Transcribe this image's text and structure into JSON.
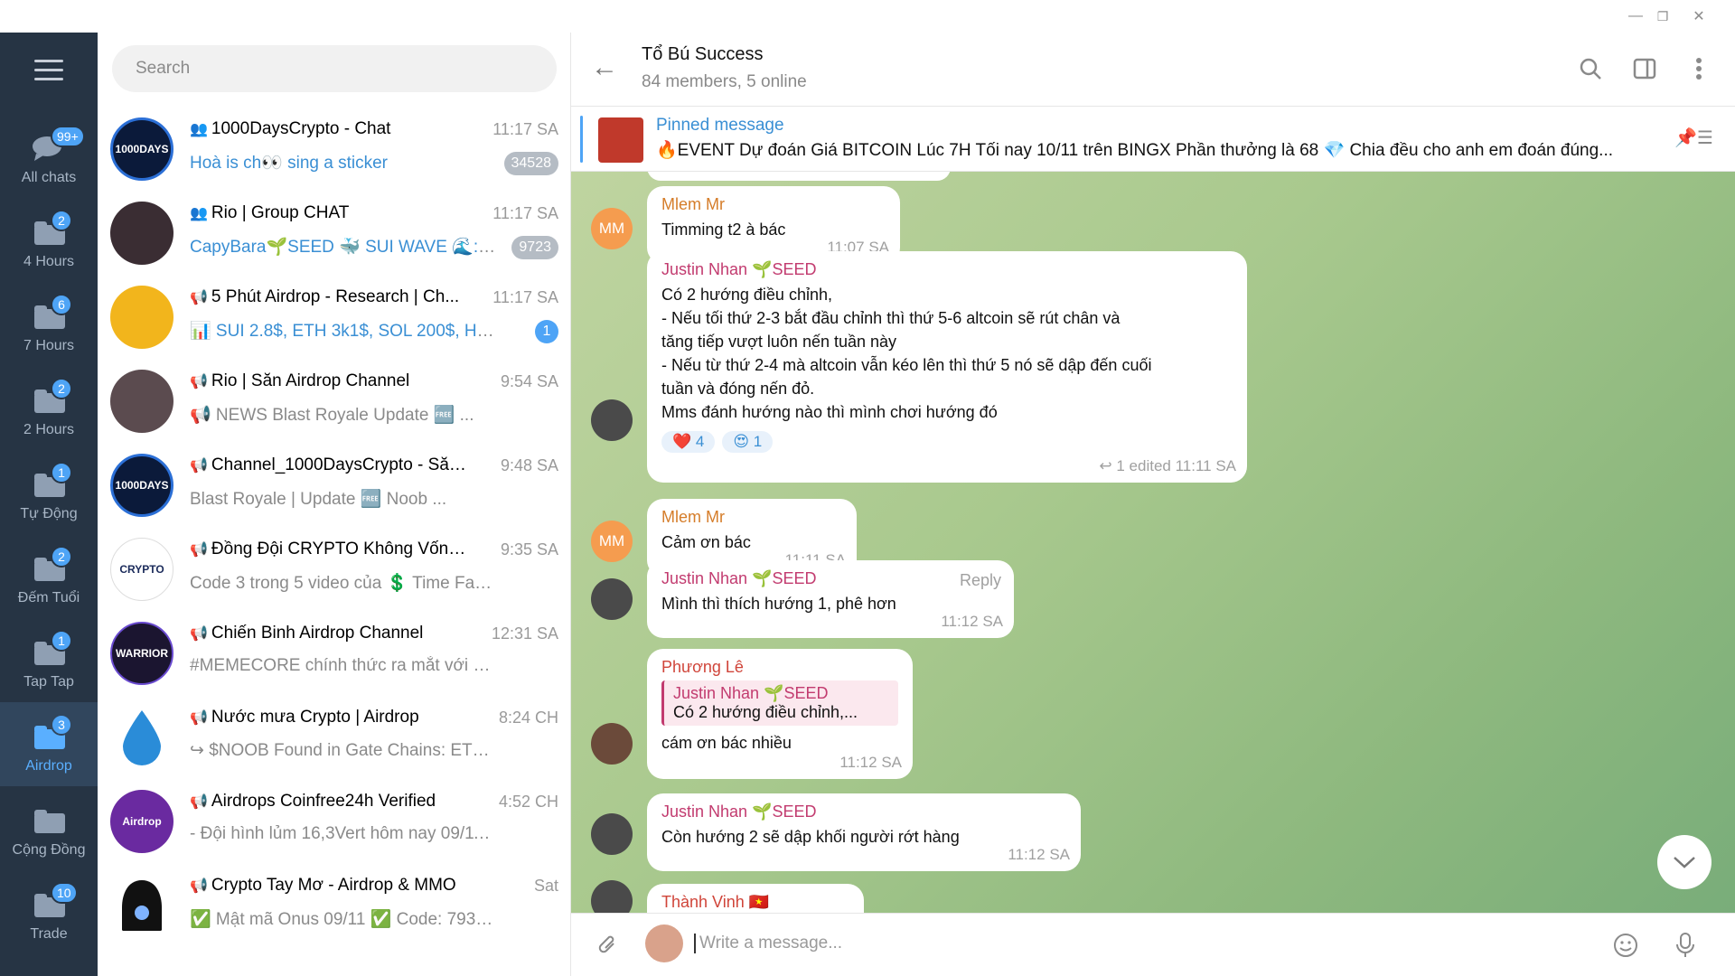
{
  "window": {
    "minimize": "—",
    "restore": "❐",
    "close": "✕"
  },
  "folders": [
    {
      "label": "All chats",
      "badge": "99+"
    },
    {
      "label": "4 Hours",
      "badge": "2"
    },
    {
      "label": "7 Hours",
      "badge": "6"
    },
    {
      "label": "2 Hours",
      "badge": "2"
    },
    {
      "label": "Tự Động",
      "badge": "1"
    },
    {
      "label": "Đếm Tuổi",
      "badge": "2"
    },
    {
      "label": "Tap Tap",
      "badge": "1"
    },
    {
      "label": "Airdrop",
      "badge": "3"
    },
    {
      "label": "Cộng Đồng",
      "badge": ""
    },
    {
      "label": "Trade",
      "badge": "10"
    }
  ],
  "search": {
    "placeholder": "Search"
  },
  "chats": [
    {
      "title": "1000DaysCrypto - Chat",
      "time": "11:17 SA",
      "preview_hl": "Hoà is ch👀 sing a sticker",
      "preview": "",
      "badge": "34528",
      "avatar_color": "#0b1a3a",
      "avatar_text": "1000DAYS"
    },
    {
      "title": "Rio | Group CHAT",
      "time": "11:17 SA",
      "preview_hl": "CapyBara🌱SEED 🐳 SUI WAVE 🌊: ...",
      "preview": "",
      "badge": "9723",
      "avatar_color": "#3a2d33",
      "avatar_text": ""
    },
    {
      "title": "5 Phút Airdrop - Research | Ch...",
      "time": "11:17 SA",
      "preview_hl": "📊 SUI 2.8$, ETH 3k1$, SOL 200$, HMST...",
      "preview": "",
      "badge": "1",
      "avatar_color": "#f2b51c",
      "avatar_text": ""
    },
    {
      "title": "Rio | Săn Airdrop Channel",
      "time": "9:54 SA",
      "preview_hl": "",
      "preview": "📢 NEWS  Blast Royale Update 🆓 ...",
      "badge": "",
      "avatar_color": "#5b4b4f",
      "avatar_text": ""
    },
    {
      "title": "Channel_1000DaysCrypto - Săn ...",
      "time": "9:48 SA",
      "preview_hl": "",
      "preview": "Blast Royale | Update 🆓 Noob ...",
      "badge": "",
      "avatar_color": "#0b1a3a",
      "avatar_text": "1000DAYS"
    },
    {
      "title": "Đồng Đội CRYPTO Không Vốn C...",
      "time": "9:35 SA",
      "preview_hl": "",
      "preview": "Code 3 trong 5 video của 💲 Time Farm...",
      "badge": "",
      "avatar_color": "#ffffff",
      "avatar_text": "CRYPTO"
    },
    {
      "title": "Chiến Binh Airdrop Channel",
      "time": "12:31 SA",
      "preview_hl": "",
      "preview": "#MEMECORE chính thức ra mắt với hơn...",
      "badge": "",
      "avatar_color": "#1b1530",
      "avatar_text": "WARRIOR"
    },
    {
      "title": "Nước mưa Crypto | Airdrop",
      "time": "8:24 CH",
      "preview_hl": "",
      "preview": "↪ $NOOB Found in Gate   Chains:  ETH  No...",
      "badge": "",
      "avatar_color": "#2a8cd8",
      "avatar_text": ""
    },
    {
      "title": "Airdrops Coinfree24h Verified",
      "time": "4:52 CH",
      "preview_hl": "",
      "preview": "- Đội hình lủm 16,3Vert hôm nay 09/11/...",
      "badge": "",
      "avatar_color": "#6a2aa0",
      "avatar_text": "Airdrop"
    },
    {
      "title": "Crypto Tay Mơ - Airdrop & MMO",
      "time": "Sat",
      "preview_hl": "",
      "preview": "✅ Mật mã Onus 09/11 ✅ Code: 793 - ...",
      "badge": "",
      "avatar_color": "#111111",
      "avatar_text": ""
    }
  ],
  "header": {
    "title": "Tổ Bú Success",
    "subtitle": "84 members, 5 online"
  },
  "pinned": {
    "label": "Pinned message",
    "text": "🔥EVENT Dự đoán Giá BITCOIN Lúc 7H Tối nay 10/11 trên BINGX  Phần thưởng là 68 💎 Chia đều cho anh em đoán đúng..."
  },
  "messages": [
    {
      "sender": "Mlem Mr",
      "text": "Timming t2 à bác",
      "time": "11:07 SA"
    },
    {
      "sender": "Justin Nhan 🌱SEED",
      "text": "Có 2 hướng điều chỉnh,\n- Nếu tối thứ 2-3 bắt đầu chỉnh thì thứ 5-6 altcoin sẽ rút chân và\ntăng tiếp vượt luôn nến tuần này\n- Nếu từ thứ 2-4 mà altcoin vẫn kéo lên thì thứ 5 nó sẽ dập đến cuối\ntuần và đóng nến đỏ.\nMms đánh hướng nào thì mình chơi hướng đó",
      "time": "↩ 1  edited 11:11 SA",
      "react1": "❤️ 4",
      "react2": "😍 1"
    },
    {
      "sender": "Mlem Mr",
      "text": "Cảm ơn bác",
      "time": "11:11 SA"
    },
    {
      "sender": "Justin Nhan 🌱SEED",
      "text": "Mình thì thích hướng 1, phê hơn",
      "time": "11:12 SA",
      "reply": "Reply"
    },
    {
      "sender": "Phương Lê",
      "quote_name": "Justin Nhan 🌱SEED",
      "quote_text": "Có 2 hướng điều chỉnh,...",
      "text": "cám ơn bác nhiều",
      "time": "11:12 SA"
    },
    {
      "sender": "Justin Nhan 🌱SEED",
      "text": "Còn hướng 2 sẽ dập khối người rớt hàng",
      "time": "11:12 SA"
    },
    {
      "sender": "Thành Vinh 🇻🇳",
      "text": "",
      "time": ""
    }
  ],
  "avatars": {
    "mm": "MM"
  },
  "composer": {
    "placeholder": "Write a message..."
  },
  "colors": {
    "accent": "#4ea4f6",
    "sidebar": "#263444",
    "sidebar_active": "#31465d"
  }
}
